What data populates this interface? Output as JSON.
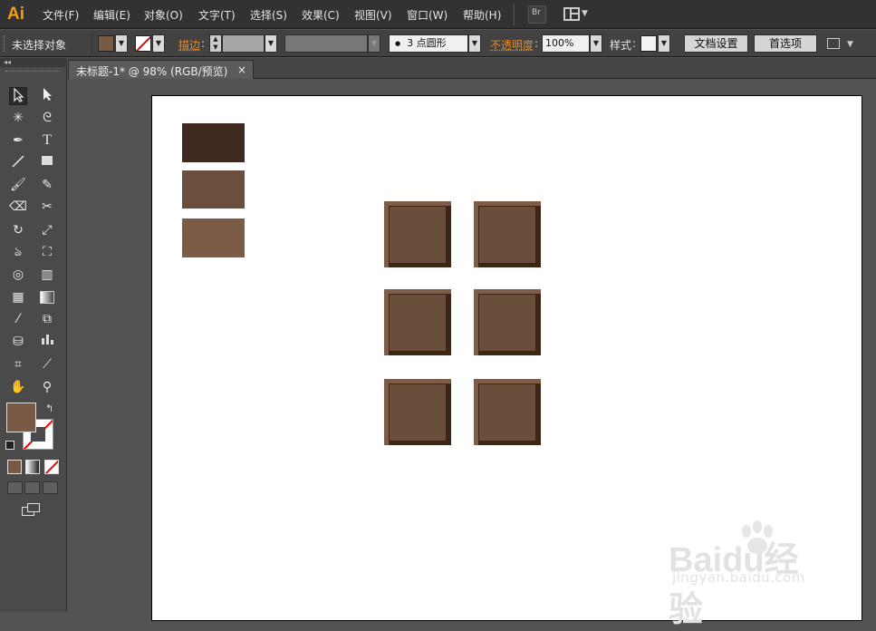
{
  "app": {
    "logo": "Ai"
  },
  "menu": [
    "文件(F)",
    "编辑(E)",
    "对象(O)",
    "文字(T)",
    "选择(S)",
    "效果(C)",
    "视图(V)",
    "窗口(W)",
    "帮助(H)"
  ],
  "menubar_buttons": {
    "bridge": "Br"
  },
  "control": {
    "selection_label": "未选择对象",
    "stroke_label": "描边",
    "stroke_profile": "3 点圆形",
    "opacity_label": "不透明度",
    "opacity_value": "100%",
    "style_label": "样式",
    "doc_settings": "文档设置",
    "preferences": "首选项"
  },
  "tab": {
    "title": "未标题-1* @ 98% (RGB/预览)",
    "close": "×"
  },
  "tools": [
    "selection-tool",
    "direct-selection-tool",
    "magic-wand-tool",
    "lasso-tool",
    "pen-tool",
    "type-tool",
    "line-tool",
    "rectangle-tool",
    "paintbrush-tool",
    "pencil-tool",
    "blob-brush-tool",
    "scissors-tool",
    "rotate-tool",
    "scale-tool",
    "warp-tool",
    "free-transform-tool",
    "shape-builder-tool",
    "graph-tool",
    "mesh-tool",
    "gradient-tool",
    "eyedropper-tool",
    "blend-tool",
    "symbol-sprayer-tool",
    "column-graph-tool",
    "artboard-tool",
    "slice-tool",
    "hand-tool",
    "zoom-tool"
  ],
  "colors": {
    "fill": "#7b5a45",
    "swatch_dark": "#3e2a1e",
    "swatch_mid": "#6b4f3e",
    "swatch_light": "#7d5c47",
    "tile_highlight": "#7e5c48",
    "tile_shadow": "#3c2616",
    "tile_face": "#6b4d3c"
  },
  "watermark": {
    "brand": "Baidu经验",
    "url": "jingyan.baidu.com"
  }
}
